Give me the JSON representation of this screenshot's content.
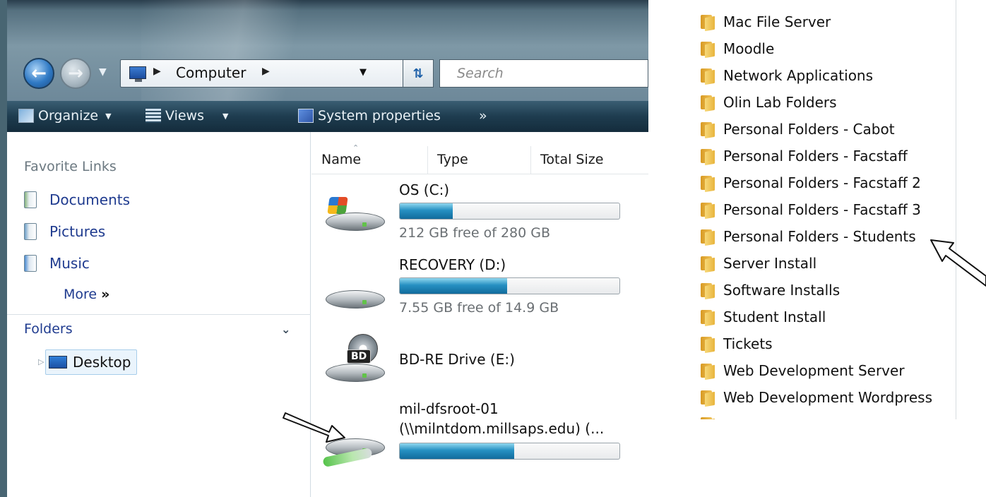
{
  "explorer": {
    "address": {
      "crumb": "Computer"
    },
    "search": {
      "placeholder": "Search"
    },
    "toolbar": {
      "organize": "Organize",
      "views": "Views",
      "system_properties": "System properties",
      "overflow": "»"
    },
    "nav_pane": {
      "favorite_heading": "Favorite Links",
      "favorites": [
        "Documents",
        "Pictures",
        "Music"
      ],
      "more": "More",
      "more_mark": "»",
      "folders_label": "Folders",
      "tree_root": "Desktop"
    },
    "columns": [
      "Name",
      "Type",
      "Total Size"
    ],
    "drives": [
      {
        "name": "OS (C:)",
        "free": "212 GB free of 280 GB",
        "used_fraction": 0.24
      },
      {
        "name": "RECOVERY (D:)",
        "free": "7.55 GB free of 14.9 GB",
        "used_fraction": 0.49
      },
      {
        "name": "BD-RE Drive (E:)",
        "badge": "BD"
      },
      {
        "name_line1": "mil-dfsroot-01",
        "name_line2": "(\\\\milntdom.millsaps.edu) (...",
        "used_fraction": 0.52
      }
    ]
  },
  "folders": [
    "Mac File Server",
    "Moodle",
    "Network Applications",
    "Olin Lab Folders",
    "Personal Folders - Cabot",
    "Personal Folders - Facstaff",
    "Personal Folders - Facstaff 2",
    "Personal Folders - Facstaff 3",
    "Personal Folders - Students",
    "Server Install",
    "Software Installs",
    "Student Install",
    "Tickets",
    "Web Development Server",
    "Web Development Wordpress"
  ],
  "colors": {
    "link_blue": "#1f3b8f",
    "toolbar_dark": "#1e3c4f",
    "progress_blue": "#2690c2",
    "folder_yellow": "#f0c35a"
  }
}
